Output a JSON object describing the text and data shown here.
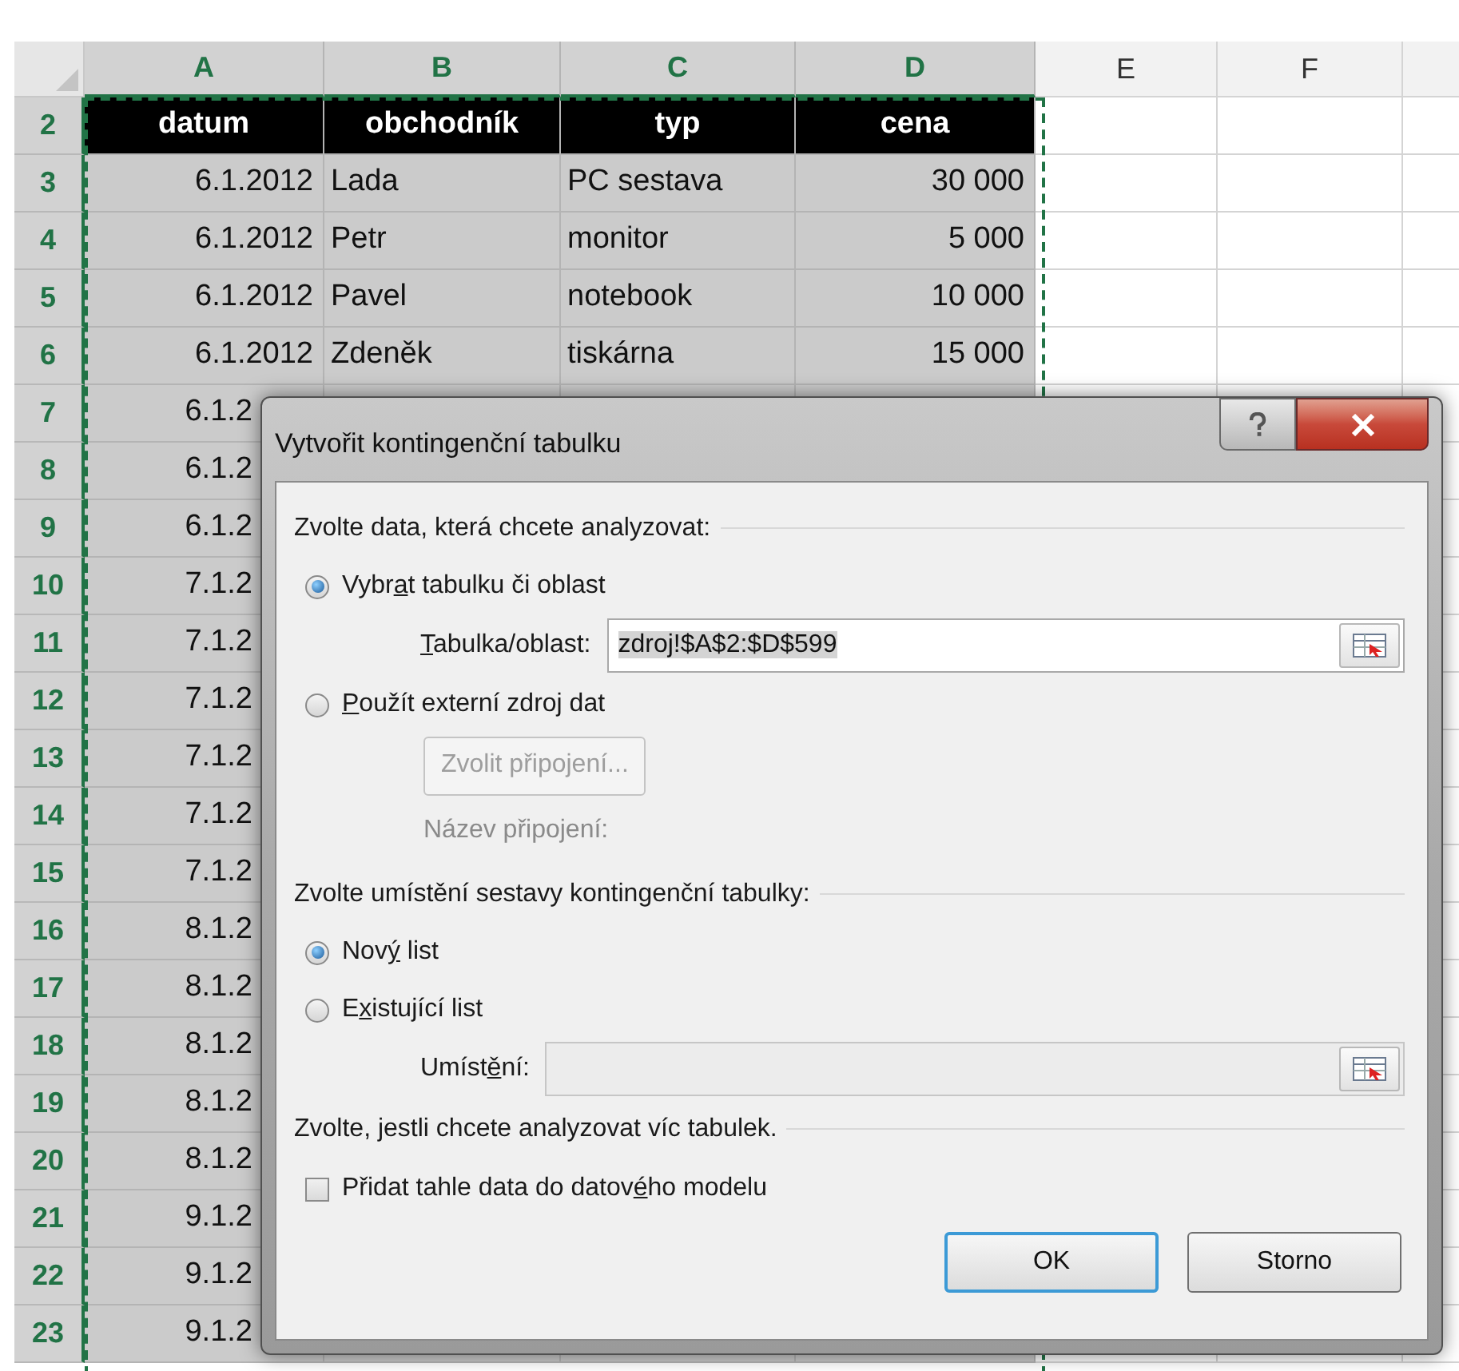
{
  "sheet": {
    "columns": [
      {
        "label": "A",
        "selected": true
      },
      {
        "label": "B",
        "selected": true
      },
      {
        "label": "C",
        "selected": true
      },
      {
        "label": "D",
        "selected": true
      },
      {
        "label": "E",
        "selected": false
      },
      {
        "label": "F",
        "selected": false
      }
    ],
    "rows": [
      {
        "number": "2",
        "kind": "header",
        "cells": [
          "datum",
          "obchodník",
          "typ",
          "cena"
        ]
      },
      {
        "number": "3",
        "kind": "data",
        "cells": [
          "6.1.2012",
          "Lada",
          "PC sestava",
          "30 000"
        ]
      },
      {
        "number": "4",
        "kind": "data",
        "cells": [
          "6.1.2012",
          "Petr",
          "monitor",
          "5 000"
        ]
      },
      {
        "number": "5",
        "kind": "data",
        "cells": [
          "6.1.2012",
          "Pavel",
          "notebook",
          "10 000"
        ]
      },
      {
        "number": "6",
        "kind": "data",
        "cells": [
          "6.1.2012",
          "Zdeněk",
          "tiskárna",
          "15 000"
        ]
      },
      {
        "number": "7",
        "kind": "cut",
        "cells": [
          "6.1.2"
        ]
      },
      {
        "number": "8",
        "kind": "cut",
        "cells": [
          "6.1.2"
        ]
      },
      {
        "number": "9",
        "kind": "cut",
        "cells": [
          "6.1.2"
        ]
      },
      {
        "number": "10",
        "kind": "cut",
        "cells": [
          "7.1.2"
        ]
      },
      {
        "number": "11",
        "kind": "cut",
        "cells": [
          "7.1.2"
        ]
      },
      {
        "number": "12",
        "kind": "cut",
        "cells": [
          "7.1.2"
        ]
      },
      {
        "number": "13",
        "kind": "cut",
        "cells": [
          "7.1.2"
        ]
      },
      {
        "number": "14",
        "kind": "cut",
        "cells": [
          "7.1.2"
        ]
      },
      {
        "number": "15",
        "kind": "cut",
        "cells": [
          "7.1.2"
        ]
      },
      {
        "number": "16",
        "kind": "cut",
        "cells": [
          "8.1.2"
        ]
      },
      {
        "number": "17",
        "kind": "cut",
        "cells": [
          "8.1.2"
        ]
      },
      {
        "number": "18",
        "kind": "cut",
        "cells": [
          "8.1.2"
        ]
      },
      {
        "number": "19",
        "kind": "cut",
        "cells": [
          "8.1.2"
        ]
      },
      {
        "number": "20",
        "kind": "cut",
        "cells": [
          "8.1.2"
        ]
      },
      {
        "number": "21",
        "kind": "cut",
        "cells": [
          "9.1.2"
        ]
      },
      {
        "number": "22",
        "kind": "cut",
        "cells": [
          "9.1.2"
        ]
      },
      {
        "number": "23",
        "kind": "cut",
        "cells": [
          "9.1.2"
        ]
      }
    ]
  },
  "dialog": {
    "title": "Vytvořit kontingenční tabulku",
    "sections": [
      {
        "heading": "Zvolte data, která chcete analyzovat:",
        "items": [
          {
            "kind": "radio",
            "label": {
              "before": "Vybr",
              "key": "a",
              "after": "t tabulku či oblast"
            },
            "selected": true
          },
          {
            "kind": "field",
            "label": {
              "key": "T",
              "after": "abulka/oblast:"
            },
            "value": "zdroj!$A$2:$D$599",
            "value_selected": true,
            "disabled": false
          },
          {
            "kind": "radio",
            "label": {
              "key": "P",
              "after": "oužít externí zdroj dat"
            },
            "selected": false
          },
          {
            "kind": "button",
            "label": "Zvolit připojení...",
            "disabled": true
          },
          {
            "kind": "note",
            "label": "Název připojení:",
            "disabled": true
          }
        ]
      },
      {
        "heading": "Zvolte umístění sestavy kontingenční tabulky:",
        "items": [
          {
            "kind": "radio",
            "label": {
              "before": "Nov",
              "key": "ý",
              "after": " list"
            },
            "selected": true
          },
          {
            "kind": "radio",
            "label": {
              "before": "E",
              "key": "x",
              "after": "istující list"
            },
            "selected": false
          },
          {
            "kind": "field",
            "label": {
              "before": "Umíst",
              "key": "ě",
              "after": "ní:"
            },
            "disabled": true
          }
        ]
      },
      {
        "heading": "Zvolte, jestli chcete analyzovat víc tabulek.",
        "items": [
          {
            "kind": "checkbox",
            "label": {
              "before": "Přidat tahle data do datov",
              "key": "é",
              "after": "ho modelu"
            },
            "checked": false
          }
        ]
      }
    ],
    "buttons": [
      {
        "label": "OK",
        "default": true
      },
      {
        "label": "Storno",
        "default": false
      }
    ]
  }
}
